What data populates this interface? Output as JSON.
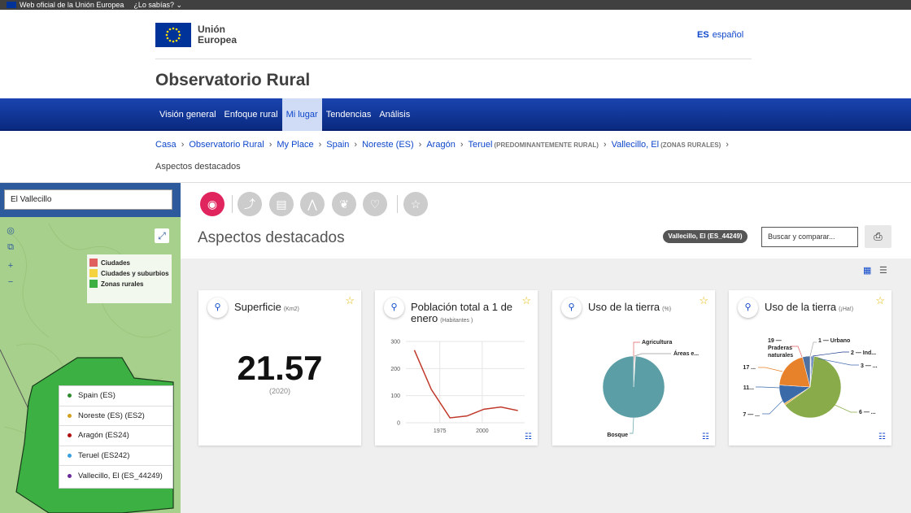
{
  "topbar": {
    "official": "Web oficial de la Unión Europea",
    "know": "¿Lo sabías?"
  },
  "header": {
    "logo_line1": "Unión",
    "logo_line2": "Europea",
    "lang_code": "ES",
    "lang_name": "español",
    "site_title": "Observatorio Rural"
  },
  "nav": [
    "Visión general",
    "Enfoque rural",
    "Mi lugar",
    "Tendencias",
    "Análisis"
  ],
  "breadcrumb": [
    {
      "label": "Casa"
    },
    {
      "label": "Observatorio Rural"
    },
    {
      "label": "My Place"
    },
    {
      "label": "Spain"
    },
    {
      "label": "Noreste (ES)"
    },
    {
      "label": "Aragón"
    },
    {
      "label": "Teruel",
      "note": "(PREDOMINANTEMENTE RURAL)"
    },
    {
      "label": "Vallecillo, El",
      "note": "(ZONAS RURALES)"
    }
  ],
  "current_page": "Aspectos destacados",
  "map": {
    "search_value": "El Vallecillo",
    "legend": [
      {
        "label": "Ciudades",
        "color": "#e06060"
      },
      {
        "label": "Ciudades y suburbios",
        "color": "#f5d33f"
      },
      {
        "label": "Zonas rurales",
        "color": "#3cb043"
      }
    ],
    "regions": [
      {
        "label": "Spain (ES)",
        "color": "#2e8b2e"
      },
      {
        "label": "Noreste (ES) (ES2)",
        "color": "#d4a020"
      },
      {
        "label": "Aragón (ES24)",
        "color": "#b01010"
      },
      {
        "label": "Teruel (ES242)",
        "color": "#3aa0e0"
      },
      {
        "label": "Vallecillo, El (ES_44249)",
        "color": "#6a2a9a"
      }
    ]
  },
  "page_heading": "Aspectos destacados",
  "place_badge": "Vallecillo, El (ES_44249)",
  "compare_placeholder": "Buscar y comparar...",
  "cards": {
    "superficie": {
      "title": "Superficie",
      "unit": "(Km2)",
      "value": "21.57",
      "year": "(2020)"
    },
    "poblacion": {
      "title": "Población total a 1 de enero",
      "unit": "(Habitantes )"
    },
    "uso1": {
      "title": "Uso de la tierra",
      "unit": "(%)"
    },
    "uso2": {
      "title": "Uso de la tierra",
      "unit": "(¡Ha!)"
    }
  },
  "chart_data": [
    {
      "type": "line",
      "title": "Población total a 1 de enero",
      "x": [
        1960,
        1970,
        1981,
        1991,
        2001,
        2011,
        2021
      ],
      "values": [
        268,
        123,
        18,
        25,
        50,
        58,
        45
      ],
      "xticks": [
        "1975",
        "2000"
      ],
      "yticks": [
        "0",
        "100",
        "200",
        "300"
      ],
      "ylim": [
        0,
        300
      ],
      "grid": true
    },
    {
      "type": "pie",
      "title": "Uso de la tierra (%)",
      "labels": [
        "Agricultura",
        "Áreas e...",
        "Bosque"
      ],
      "values": [
        0.5,
        0.5,
        99
      ]
    },
    {
      "type": "pie",
      "title": "Uso de la tierra (¡Ha!)",
      "labels": [
        "1 — Urbano",
        "2 — Ind...",
        "3 — ...",
        "6 — ...",
        "7 — ...",
        "11...",
        "17 ...",
        "19 — Praderas naturales"
      ],
      "values": [
        0.5,
        0.5,
        1,
        63,
        1,
        10,
        20,
        4
      ],
      "colors": [
        "#d0d0d0",
        "#1a3a8a",
        "#406ab0",
        "#8aab4a",
        "#e8b04a",
        "#3a6aa8",
        "#e8822a",
        "#5070a0"
      ]
    }
  ]
}
